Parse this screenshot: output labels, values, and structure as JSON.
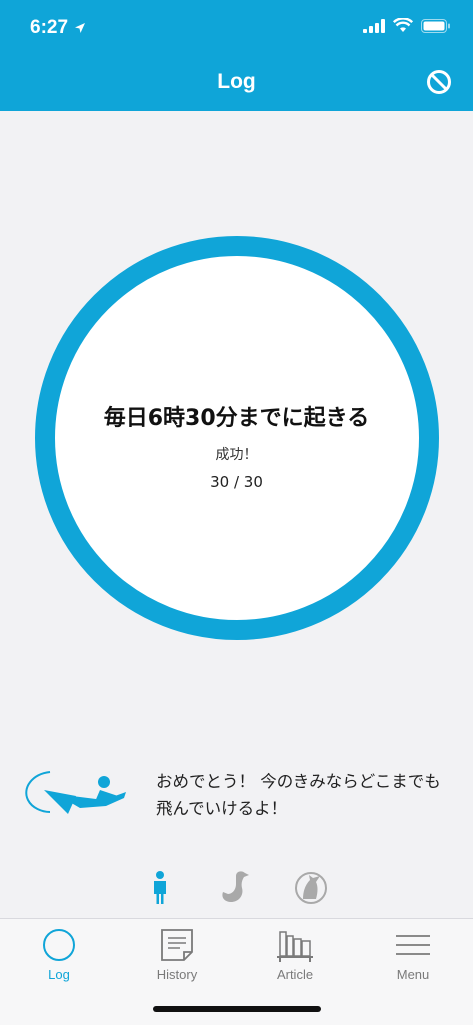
{
  "status_bar": {
    "time": "6:27"
  },
  "header": {
    "title": "Log",
    "action_icon": "block-icon",
    "color": "#0fa5d8"
  },
  "goal": {
    "title": "毎日6時30分までに起きる",
    "status": "成功！",
    "progress_text": "30 / 30",
    "completed": 30,
    "total": 30,
    "ring_color": "#10a5d8"
  },
  "message": {
    "icon": "flying-hero-icon",
    "text": "おめでとう！ 今のきみならどこまでも飛んでいけるよ！"
  },
  "characters": [
    {
      "name": "person-icon",
      "selected": true
    },
    {
      "name": "duck-icon",
      "selected": false
    },
    {
      "name": "wolf-icon",
      "selected": false
    }
  ],
  "tabs": [
    {
      "label": "Log",
      "icon": "circle-icon",
      "active": true
    },
    {
      "label": "History",
      "icon": "document-icon",
      "active": false
    },
    {
      "label": "Article",
      "icon": "bookshelf-icon",
      "active": false
    },
    {
      "label": "Menu",
      "icon": "hamburger-icon",
      "active": false
    }
  ]
}
